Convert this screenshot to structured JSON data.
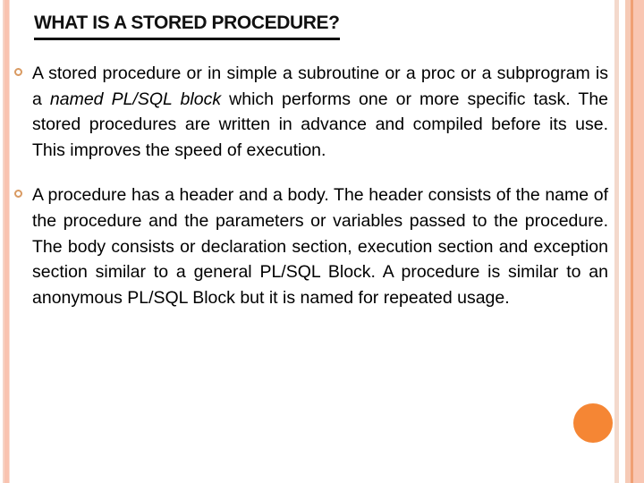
{
  "slide": {
    "title": "WHAT IS A STORED PROCEDURE?",
    "background_color": "#ffffff",
    "text_color": "#000000",
    "accent_color": "#f58634",
    "bullet_marker_color": "#d99a62",
    "stripe_colors": [
      "#f6d4c6",
      "#f9c3b0",
      "#fadfd4",
      "#f4d9cc",
      "#f6cab6",
      "#f0a074",
      "#f9c6b2"
    ],
    "bullets": [
      {
        "marker": "hollow-ring-bullet",
        "text_before_italic": "A stored procedure or in simple a subroutine or a proc or a subprogram is a ",
        "italic_text": "named PL/SQL block",
        "text_after_italic": " which performs one or more specific task. The stored procedures are written in advance and compiled before its use. This improves the speed of execution.",
        "full_text": "A stored procedure or in simple a subroutine or a proc or a subprogram is a named PL/SQL block which performs one or more specific task. The stored procedures are written in advance and compiled before its use. This improves the speed of execution."
      },
      {
        "marker": "hollow-ring-bullet",
        "text_before_italic": "A procedure has a header and a body. The header consists of the name of the procedure and the parameters or variables passed to the procedure. The body consists or declaration section, execution section and exception section similar to a general PL/SQL Block. A procedure is similar to an anonymous PL/SQL Block but it is named for repeated usage.",
        "italic_text": "",
        "text_after_italic": "",
        "full_text": "A procedure has a header and a body. The header consists of the name of the procedure and the parameters or variables passed to the procedure. The body consists or declaration section, execution section and exception section similar to a general PL/SQL Block. A procedure is similar to an anonymous PL/SQL Block but it is named for repeated usage."
      }
    ]
  }
}
